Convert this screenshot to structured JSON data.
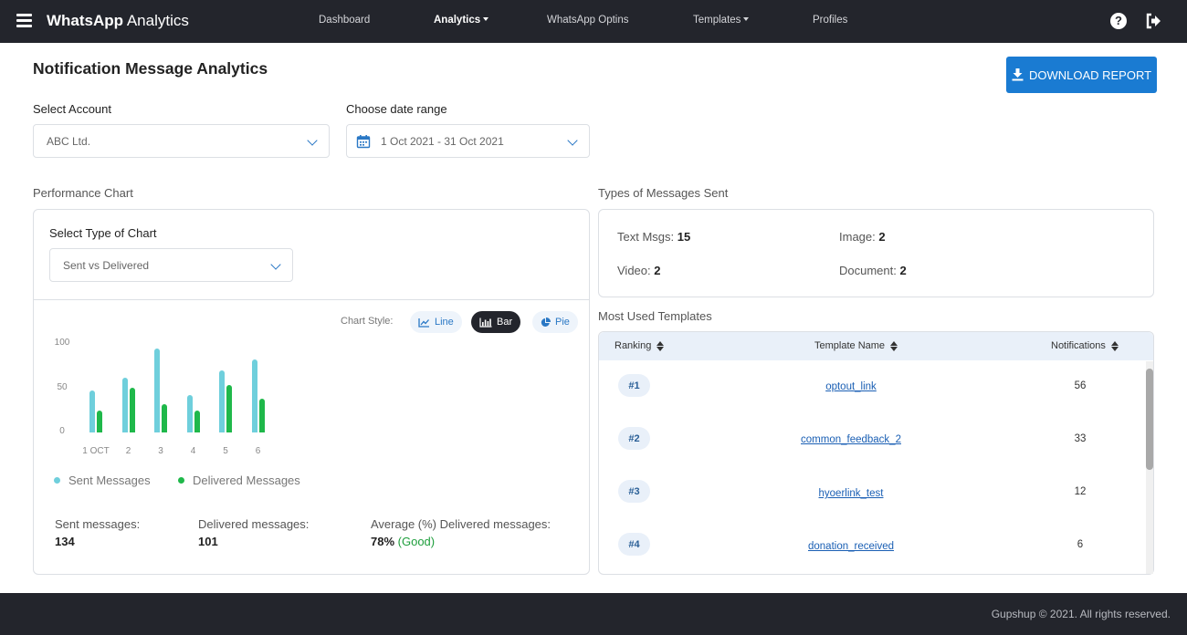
{
  "header": {
    "brand_bold": "WhatsApp",
    "brand_rest": " Analytics",
    "nav": [
      {
        "label": "Dashboard"
      },
      {
        "label": "Analytics"
      },
      {
        "label": "WhatsApp Optins"
      },
      {
        "label": "Templates"
      },
      {
        "label": "Profiles"
      }
    ],
    "help_glyph": "?"
  },
  "page": {
    "title": "Notification Message Analytics",
    "download_label": "DOWNLOAD REPORT"
  },
  "filters": {
    "account_label": "Select Account",
    "account_value": "ABC Ltd.",
    "date_label": "Choose date range",
    "date_value": "1 Oct 2021 - 31 Oct 2021"
  },
  "performance": {
    "section_label": "Performance Chart",
    "chart_type_label": "Select Type of Chart",
    "chart_type_value": "Sent vs Delivered",
    "chart_style_label": "Chart Style:",
    "styles": [
      {
        "label": "Line"
      },
      {
        "label": "Bar"
      },
      {
        "label": "Pie"
      }
    ],
    "stats": {
      "sent_label": "Sent messages:",
      "sent_value": "134",
      "delivered_label": "Delivered messages:",
      "delivered_value": "101",
      "avg_label": "Average (%) Delivered messages:",
      "avg_value": "78%",
      "avg_quality": "(Good)"
    }
  },
  "chart_data": {
    "type": "bar",
    "categories": [
      "1 OCT",
      "2",
      "3",
      "4",
      "5",
      "6"
    ],
    "yticks": [
      "100",
      "50",
      "0"
    ],
    "ylim": [
      0,
      100
    ],
    "series": [
      {
        "name": "Sent Messages",
        "color": "#6fcfdc",
        "values": [
          47,
          62,
          95,
          42,
          70,
          82
        ]
      },
      {
        "name": "Delivered Messages",
        "color": "#1fb84a",
        "values": [
          25,
          51,
          32,
          25,
          54,
          38
        ]
      }
    ]
  },
  "types": {
    "section_label": "Types of Messages Sent",
    "items": [
      {
        "label": "Text Msgs:",
        "value": "15"
      },
      {
        "label": "Image:",
        "value": "2"
      },
      {
        "label": "Video:",
        "value": "2"
      },
      {
        "label": "Document:",
        "value": "2"
      }
    ]
  },
  "templates": {
    "section_label": "Most Used Templates",
    "columns": [
      "Ranking",
      "Template Name",
      "Notifications"
    ],
    "rows": [
      {
        "rank": "#1",
        "name": "optout_link",
        "count": "56"
      },
      {
        "rank": "#2",
        "name": "common_feedback_2",
        "count": "33"
      },
      {
        "rank": "#3",
        "name": "hyoerlink_test",
        "count": "12"
      },
      {
        "rank": "#4",
        "name": "donation_received",
        "count": "6"
      }
    ]
  },
  "footer": {
    "text": "Gupshup © 2021. All rights reserved."
  },
  "colors": {
    "header_bg": "#23252c",
    "primary": "#1a7bd2",
    "good": "#1e9e3c"
  }
}
